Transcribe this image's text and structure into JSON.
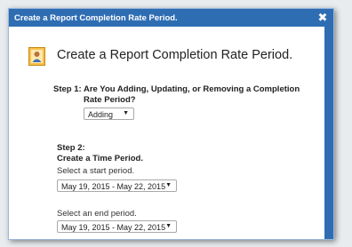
{
  "dialog": {
    "title": "Create a Report Completion Rate Period.",
    "close_glyph": "✖"
  },
  "header": {
    "title": "Create a Report Completion Rate Period."
  },
  "step1": {
    "label": "Step 1:",
    "question": "Are You Adding, Updating, or Removing a Completion Rate Period?",
    "action_select": {
      "value": "Adding"
    }
  },
  "step2": {
    "label": "Step 2:",
    "subtitle": "Create a Time Period.",
    "start_label": "Select a start period.",
    "start_select": {
      "value": "May 19, 2015 - May 22, 2015"
    },
    "end_label": "Select an end period.",
    "end_select": {
      "value": "May 19, 2015 - May 22, 2015"
    }
  },
  "colors": {
    "titlebar": "#2f6db3",
    "scrollbar": "#2f6db3"
  },
  "icons": {
    "header": "user-report-icon",
    "select_arrow": "chevron-down-icon"
  }
}
